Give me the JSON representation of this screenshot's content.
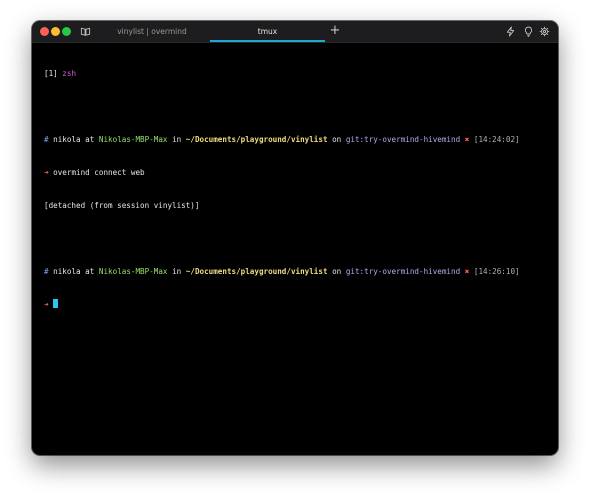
{
  "window": {
    "tabs": [
      {
        "label": "vinylist | overmind",
        "active": false
      },
      {
        "label": "tmux",
        "active": true
      }
    ],
    "new_tab_glyph": "+",
    "titlebar_icons": [
      "lightning-icon",
      "lightbulb-icon",
      "gear-icon"
    ]
  },
  "terminal": {
    "header": {
      "index": "[1]",
      "shell": "zsh"
    },
    "prompt1": {
      "hash": "#",
      "user": "nikola",
      "at": "at",
      "host": "Nikolas-MBP-Max",
      "in": "in",
      "path": "~/Documents/playground/vinylist",
      "on": "on",
      "branch": "git:try-overmind-hivemind",
      "status": "✖",
      "time": "[14:24:02]"
    },
    "command1": {
      "arrow": "➜",
      "text": "overmind connect web"
    },
    "output1": "[detached (from session vinylist)]",
    "prompt2": {
      "hash": "#",
      "user": "nikola",
      "at": "at",
      "host": "Nikolas-MBP-Max",
      "in": "in",
      "path": "~/Documents/playground/vinylist",
      "on": "on",
      "branch": "git:try-overmind-hivemind",
      "status": "✖",
      "time": "[14:26:10]"
    },
    "command2": {
      "arrow": "➜",
      "text": ""
    }
  },
  "colors": {
    "accent": "#1ea6d6",
    "cursor": "#2ec3f0",
    "host": "#98e06b",
    "path": "#f0dc82",
    "branch": "#b6a8ef",
    "error": "#ff5c57",
    "hash": "#7aa2f7"
  }
}
